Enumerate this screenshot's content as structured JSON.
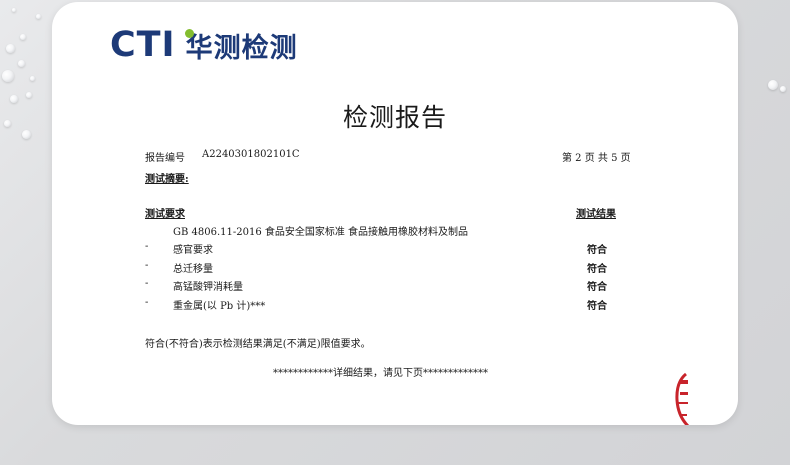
{
  "logo": {
    "brand": "CTI",
    "name_cn": "华测检测"
  },
  "report": {
    "title": "检测报告",
    "number_label": "报告编号",
    "number": "A2240301802101C",
    "page_info": "第 2 页  共 5 页",
    "summary_heading": "测试摘要:",
    "col_requirement": "测试要求",
    "col_result": "测试结果",
    "standard": "GB 4806.11-2016  食品安全国家标准  食品接触用橡胶材料及制品",
    "items": [
      {
        "bullet": "-",
        "name": "感官要求",
        "result": "符合"
      },
      {
        "bullet": "-",
        "name": "总迁移量",
        "result": "符合"
      },
      {
        "bullet": "-",
        "name": "高锰酸钾消耗量",
        "result": "符合"
      },
      {
        "bullet": "-",
        "name": "重金属(以 Pb 计)***",
        "result": "符合"
      }
    ],
    "note": "符合(不符合)表示检测结果满足(不满足)限值要求。",
    "details_line": "************详细结果，请见下页*************"
  },
  "colors": {
    "brand_blue": "#1d3a78",
    "brand_green": "#84bd2f",
    "stamp_red": "#c8242b"
  }
}
